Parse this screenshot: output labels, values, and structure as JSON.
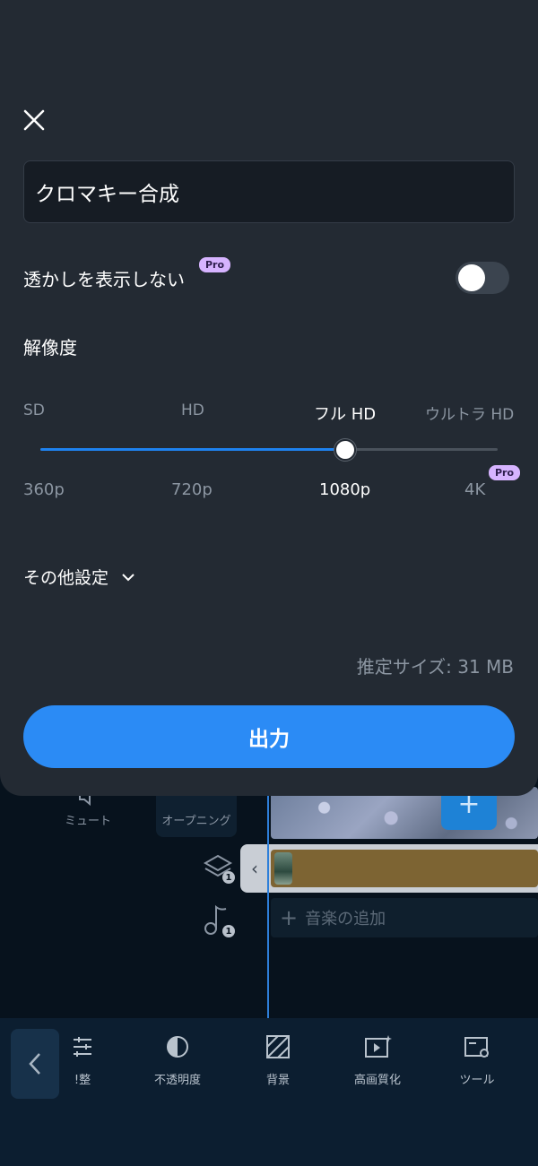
{
  "editor": {
    "mute_label": "ミュート",
    "opening_label": "オープニング",
    "layer_count": "1",
    "music_count": "1",
    "music_add_label": "音楽の追加",
    "toolbar": [
      {
        "label": "!整",
        "icon": "sliders-icon"
      },
      {
        "label": "不透明度",
        "icon": "opacity-icon"
      },
      {
        "label": "背景",
        "icon": "background-icon"
      },
      {
        "label": "高画質化",
        "icon": "enhance-icon"
      },
      {
        "label": "ツール",
        "icon": "tools-icon"
      }
    ]
  },
  "sheet": {
    "title_value": "クロマキー合成",
    "watermark_label": "透かしを表示しない",
    "pro_label": "Pro",
    "watermark_toggle_on": false,
    "resolution_title": "解像度",
    "quality_labels": [
      "SD",
      "HD",
      "フル HD",
      "ウルトラ HD"
    ],
    "resolution_labels": [
      "360p",
      "720p",
      "1080p",
      "4K"
    ],
    "selected_index": 2,
    "other_settings_label": "その他設定",
    "estimated_size": "推定サイズ: 31 MB",
    "export_label": "出力"
  },
  "colors": {
    "accent": "#2b8bf5",
    "sheet_bg": "#232a33",
    "pro_badge": "#d6b3ff"
  }
}
